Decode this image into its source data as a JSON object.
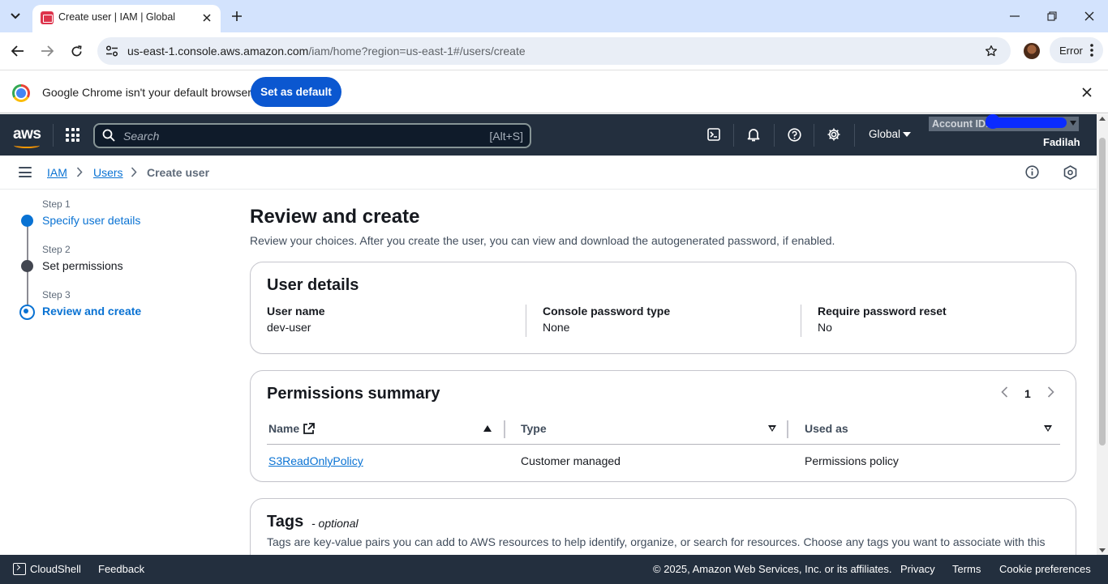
{
  "browser": {
    "tab_title": "Create user | IAM | Global",
    "url_host": "us-east-1.console.aws.amazon.com",
    "url_path": "/iam/home?region=us-east-1#/users/create",
    "error_label": "Error",
    "infobar_text": "Google Chrome isn't your default browser",
    "set_default_label": "Set as default"
  },
  "aws_nav": {
    "logo": "aws",
    "search_placeholder": "Search",
    "search_shortcut": "[Alt+S]",
    "region": "Global",
    "account_label": "Account ID:",
    "username": "Fadilah"
  },
  "breadcrumb": {
    "items": [
      "IAM",
      "Users",
      "Create user"
    ]
  },
  "steps": [
    {
      "number": "Step 1",
      "title": "Specify user details",
      "state": "done"
    },
    {
      "number": "Step 2",
      "title": "Set permissions",
      "state": "pending"
    },
    {
      "number": "Step 3",
      "title": "Review and create",
      "state": "current"
    }
  ],
  "page": {
    "title": "Review and create",
    "description": "Review your choices. After you create the user, you can view and download the autogenerated password, if enabled."
  },
  "user_details": {
    "title": "User details",
    "fields": [
      {
        "label": "User name",
        "value": "dev-user"
      },
      {
        "label": "Console password type",
        "value": "None"
      },
      {
        "label": "Require password reset",
        "value": "No"
      }
    ]
  },
  "permissions": {
    "title": "Permissions summary",
    "page": "1",
    "columns": [
      "Name",
      "Type",
      "Used as"
    ],
    "rows": [
      {
        "name": "S3ReadOnlyPolicy",
        "type": "Customer managed",
        "used_as": "Permissions policy"
      }
    ]
  },
  "tags": {
    "title": "Tags",
    "optional": "- optional",
    "description": "Tags are key-value pairs you can add to AWS resources to help identify, organize, or search for resources. Choose any tags you want to associate with this"
  },
  "footer": {
    "cloudshell": "CloudShell",
    "feedback": "Feedback",
    "copyright": "© 2025, Amazon Web Services, Inc. or its affiliates.",
    "privacy": "Privacy",
    "terms": "Terms",
    "cookies": "Cookie preferences"
  },
  "colors": {
    "aws_nav_bg": "#232f3e",
    "aws_orange": "#ff9900",
    "link_blue": "#0972d3",
    "chrome_tab_bg": "#d3e3fd",
    "chrome_button_blue": "#0b57d0"
  }
}
